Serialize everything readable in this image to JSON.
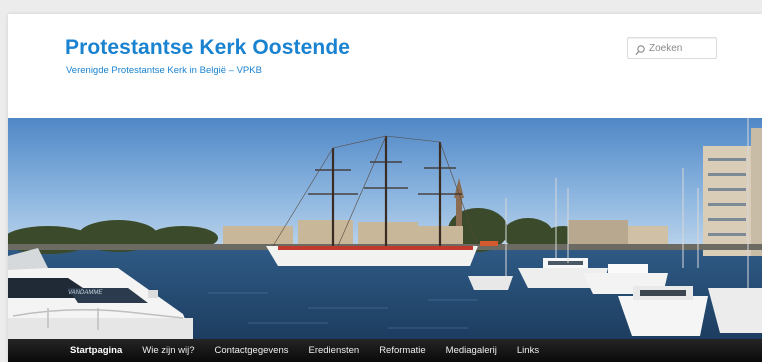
{
  "site": {
    "title": "Protestantse Kerk Oostende",
    "description": "Verenigde Protestantse Kerk in België – VPKB",
    "title_color": "#1982d1"
  },
  "search": {
    "placeholder": "Zoeken",
    "icon": "search-icon"
  },
  "header_image": {
    "alt": "",
    "boat_name": "VANDAMME"
  },
  "nav": {
    "items": [
      {
        "label": "Startpagina",
        "current": true
      },
      {
        "label": "Wie zijn wij?",
        "current": false
      },
      {
        "label": "Contactgegevens",
        "current": false
      },
      {
        "label": "Erediensten",
        "current": false
      },
      {
        "label": "Reformatie",
        "current": false
      },
      {
        "label": "Mediagalerij",
        "current": false
      },
      {
        "label": "Links",
        "current": false
      }
    ],
    "background": "#111111"
  }
}
